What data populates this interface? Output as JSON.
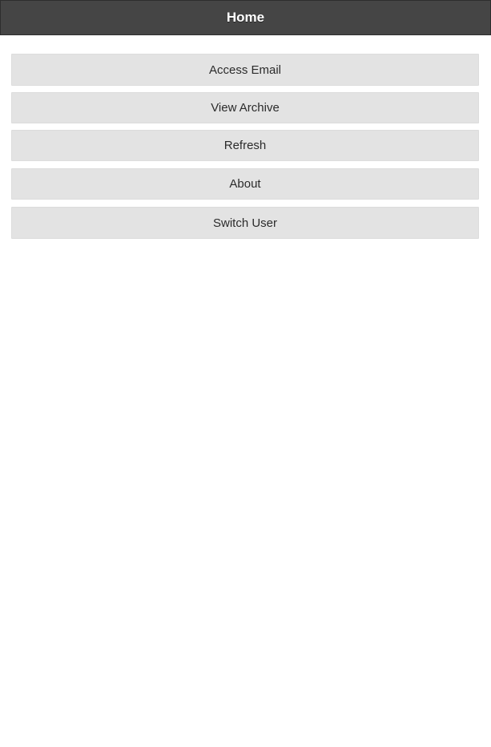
{
  "header": {
    "title": "Home"
  },
  "menu": {
    "items": [
      {
        "label": "Access Email"
      },
      {
        "label": "View Archive"
      },
      {
        "label": "Refresh"
      },
      {
        "label": "About"
      },
      {
        "label": "Switch User"
      }
    ]
  },
  "colors": {
    "header_bg": "#454545",
    "button_bg": "#e3e3e3",
    "text": "#2b2b2b"
  }
}
